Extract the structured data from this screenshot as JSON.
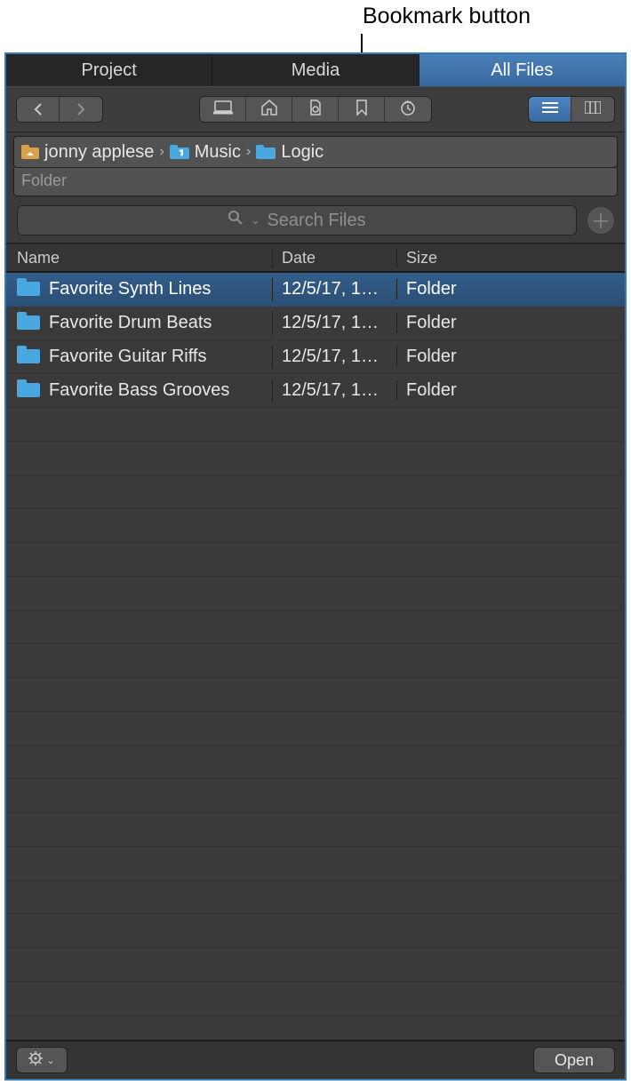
{
  "callout": {
    "label": "Bookmark button"
  },
  "tabs": {
    "project": "Project",
    "media": "Media",
    "allfiles": "All Files"
  },
  "path": {
    "seg0": "jonny applese",
    "seg1": "Music",
    "seg2": "Logic",
    "under_label": "Folder"
  },
  "search": {
    "placeholder": "Search Files"
  },
  "columns": {
    "name": "Name",
    "date": "Date",
    "size": "Size"
  },
  "rows": [
    {
      "name": "Favorite Synth Lines",
      "date": "12/5/17, 1…",
      "size": "Folder"
    },
    {
      "name": "Favorite Drum Beats",
      "date": "12/5/17, 1…",
      "size": "Folder"
    },
    {
      "name": "Favorite Guitar Riffs",
      "date": "12/5/17, 1…",
      "size": "Folder"
    },
    {
      "name": "Favorite Bass Grooves",
      "date": "12/5/17, 1…",
      "size": "Folder"
    }
  ],
  "footer": {
    "open": "Open"
  }
}
